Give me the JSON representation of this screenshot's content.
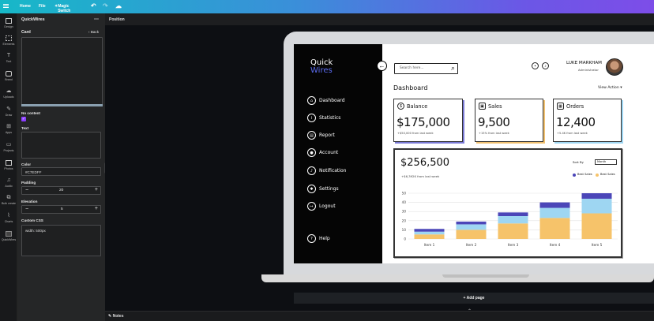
{
  "topbar": {
    "home": "Home",
    "file": "File",
    "magic_switch": "Magic Switch"
  },
  "rail": [
    "Design",
    "Elements",
    "Text",
    "Brand",
    "Uploads",
    "Draw",
    "Apps",
    "Projects",
    "Photos",
    "Audio",
    "Bulk create",
    "Charts",
    "QuickWires"
  ],
  "panel": {
    "title": "QuickWires",
    "section": "Card",
    "back": "Back",
    "no_content_label": "No content",
    "text_label": "Text",
    "color_label": "Color",
    "color_value": "#C7EDFF",
    "padding_label": "Padding",
    "padding_value": "20",
    "elevation_label": "Elevation",
    "elevation_value": "5",
    "css_label": "Custom CSS",
    "css_value": "width: 500px"
  },
  "canvas": {
    "position_label": "Position",
    "add_page": "+ Add page",
    "notes": "Notes"
  },
  "dashboard": {
    "logo_line1": "Quick",
    "logo_line2": "Wires",
    "nav": [
      "Dashboard",
      "Statistics",
      "Report",
      "Account",
      "Notification",
      "Settings",
      "Logout"
    ],
    "help": "Help",
    "search_placeholder": "Search here...",
    "user_name": "LUKE MARKHAM",
    "user_role": "Administrator",
    "page_title": "Dashboard",
    "view_action": "View Action",
    "cards": [
      {
        "label": "Balance",
        "value": "$175,000",
        "sub": "+$50,000 from last week",
        "color": "#7a7ad6"
      },
      {
        "label": "Sales",
        "value": "9,500",
        "sub": "+15% from last week",
        "color": "#f0c070"
      },
      {
        "label": "Orders",
        "value": "12,400",
        "sub": "+5.4K from last week",
        "color": "#9ed6f2"
      }
    ],
    "chart_total": "$256,500",
    "chart_sub": "+$6,392K from last week",
    "sort_label": "Sort By",
    "sort_value": "Month",
    "legend": [
      "Best Sales",
      "Best Sales"
    ]
  },
  "chart_data": {
    "type": "bar",
    "stacked": true,
    "categories": [
      "Item 1",
      "Item 2",
      "Item 3",
      "Item 4",
      "Item 5"
    ],
    "series": [
      {
        "values": [
          5,
          10,
          17,
          23,
          28
        ],
        "color": "#f6c36a"
      },
      {
        "values": [
          3,
          6,
          8,
          11,
          16
        ],
        "color": "#9ed6f2"
      },
      {
        "values": [
          3,
          3,
          4,
          6,
          6
        ],
        "color": "#4b46b8"
      }
    ],
    "yticks": [
      0,
      10,
      20,
      30,
      40,
      50
    ],
    "ylim": [
      0,
      50
    ]
  }
}
